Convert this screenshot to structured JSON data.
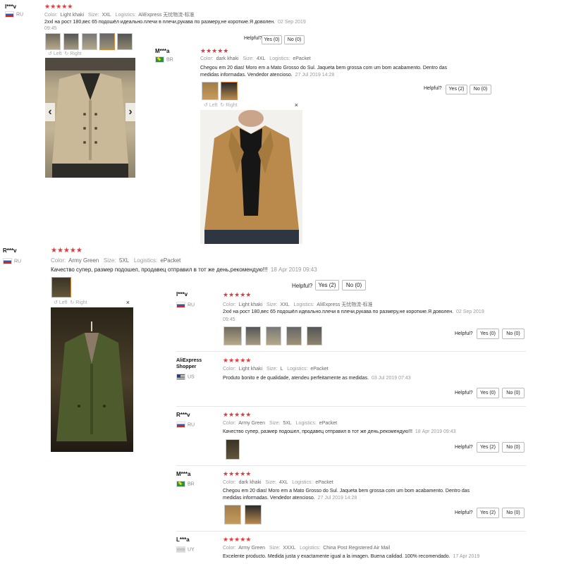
{
  "common": {
    "color_label": "Color:",
    "size_label": "Size:",
    "logistics_label": "Logistics:",
    "helpful_label": "Helpful?",
    "rotate_left": "Left",
    "rotate_right": "Right",
    "close": "×",
    "prev": "‹",
    "next": "›",
    "stars": "★★★★★"
  },
  "review_top": {
    "user": "I***v",
    "country": "RU",
    "color": "Light khaki",
    "size": "XXL",
    "logistics": "AliExpress 无忧物流-标准",
    "text": "2xxl на рост 180,вес 65 подошёл идеально.плечи в плечи,рукава по размеру,не короткие.Я доволен.",
    "date": "02 Sep 2019",
    "time": "09:45",
    "yes": "Yes (0)",
    "no": "No (0)"
  },
  "review_brazil_1": {
    "user": "M***a",
    "country": "BR",
    "color": "dark khaki",
    "size": "4XL",
    "logistics": "ePacket",
    "text": "Chegou em 20 dias! Moro em a Mato Grosso do Sul. Jaqueta bem grossa com um bom acabamento. Dentro das medidas informadas. Vendedor atencioso.",
    "date": "27 Jul 2019 14:28",
    "yes": "Yes (2)",
    "no": "No (0)"
  },
  "review_ru_2": {
    "user": "R***v",
    "country": "RU",
    "color": "Army Green",
    "size": "5XL",
    "logistics": "ePacket",
    "text": "Качество супер, размер подошел, продавец отправил в тот же день,рекомендую!!!",
    "date": "18 Apr 2019 09:43",
    "yes": "Yes (2)",
    "no": "No (0)"
  },
  "list": [
    {
      "user": "I***v",
      "country": "RU",
      "color": "Light khaki",
      "size": "XXL",
      "logistics": "AliExpress 无忧物流-标准",
      "text": "2xxl на рост 180,вес 65 подошёл идеально.плечи в плечи,рукава по размеру,не короткие.Я доволен.",
      "date": "02 Sep 2019",
      "time": "09:45",
      "yes": "Yes (0)",
      "no": "No (0)"
    },
    {
      "user_line1": "AliExpress",
      "user_line2": "Shopper",
      "country": "US",
      "color": "Light khaki",
      "size": "L",
      "logistics": "ePacket",
      "text": "Produto bonito e de qualidade, atendeu perfeitamente as medidas.",
      "date": "03 Jul 2019 07:43",
      "yes": "Yes (0)",
      "no": "No (0)"
    },
    {
      "user": "R***v",
      "country": "RU",
      "color": "Army Green",
      "size": "5XL",
      "logistics": "ePacket",
      "text": "Качество супер, размер подошел, продавец отправил в тот же день,рекомендую!!!",
      "date": "18 Apr 2019 09:43",
      "yes": "Yes (2)",
      "no": "No (0)"
    },
    {
      "user": "M***a",
      "country": "BR",
      "color": "dark khaki",
      "size": "4XL",
      "logistics": "ePacket",
      "text1": "Chegou em 20 dias! Moro em a Mato Grosso do Sul. Jaqueta bem grossa com um bom acabamento. Dentro das",
      "text2": "medidas informadas. Vendedor atencioso.",
      "date": "27 Jul 2019 14:28",
      "yes": "Yes (2)",
      "no": "No (0)"
    },
    {
      "user": "L***a",
      "country": "UY",
      "color": "Army Green",
      "size": "XXXL",
      "logistics": "China Post Registered Air Mail",
      "text": "Excelente producto. Medida justa y exactamente igual a la imagen. Buena calidad. 100% recomendado.",
      "date": "17 Apr 2019"
    }
  ]
}
